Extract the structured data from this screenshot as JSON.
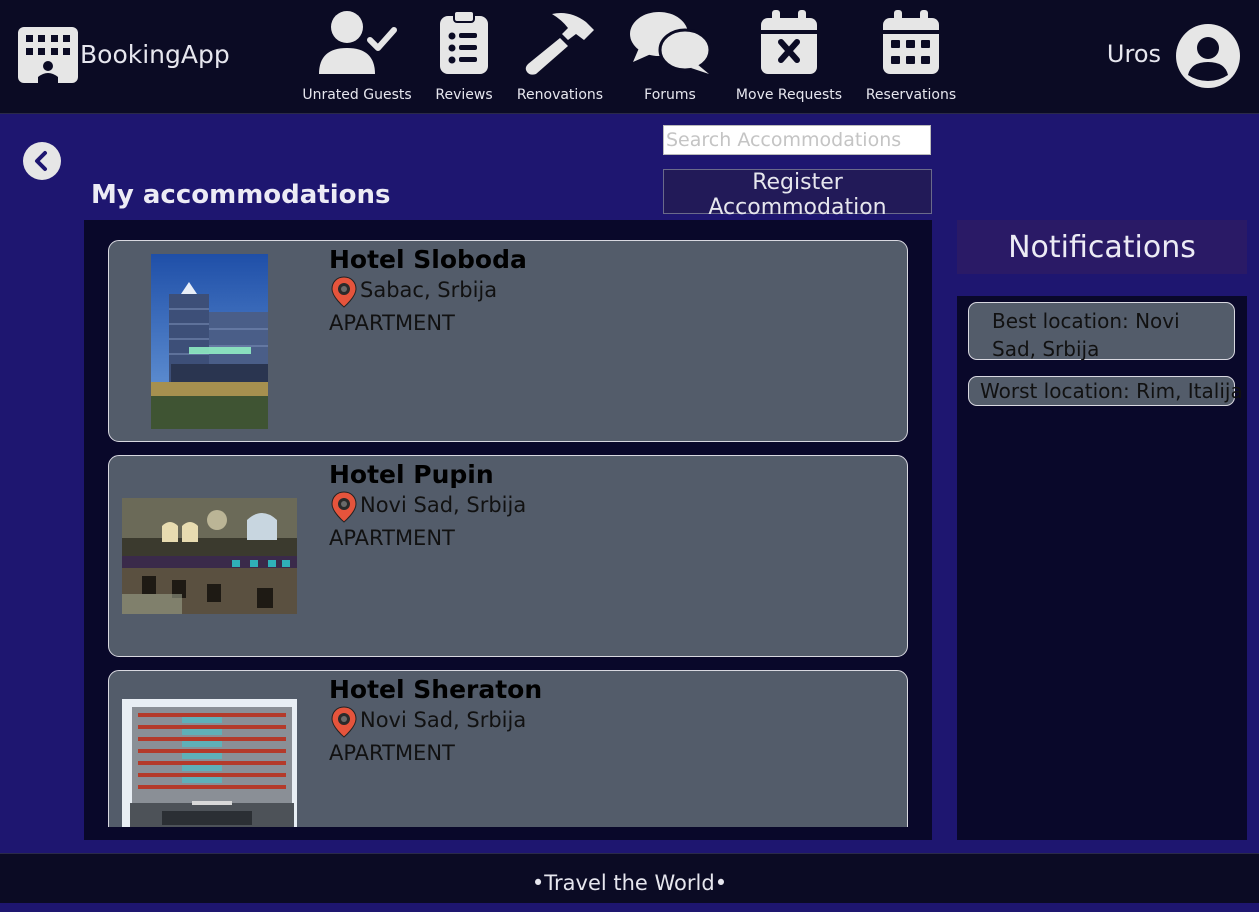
{
  "header": {
    "brand": "BookingApp",
    "nav": [
      {
        "label": "Unrated Guests",
        "icon": "user-check-icon"
      },
      {
        "label": "Reviews",
        "icon": "clipboard-list-icon"
      },
      {
        "label": "Renovations",
        "icon": "hammer-icon"
      },
      {
        "label": "Forums",
        "icon": "chat-bubbles-icon"
      },
      {
        "label": "Move Requests",
        "icon": "calendar-x-icon"
      },
      {
        "label": "Reservations",
        "icon": "calendar-grid-icon"
      }
    ],
    "username": "Uros"
  },
  "main": {
    "title": "My accommodations",
    "search_placeholder": "Search Accommodations",
    "search_value": "",
    "register_label": "Register Accommodation",
    "accommodations": [
      {
        "name": "Hotel Sloboda",
        "location": "Sabac, Srbija",
        "type": "APARTMENT"
      },
      {
        "name": "Hotel Pupin",
        "location": "Novi Sad, Srbija",
        "type": "APARTMENT"
      },
      {
        "name": "Hotel Sheraton",
        "location": "Novi Sad, Srbija",
        "type": "APARTMENT"
      }
    ]
  },
  "notifications": {
    "title": "Notifications",
    "items": [
      "Best location: Novi Sad, Srbija",
      "Worst location: Rim, Italija"
    ]
  },
  "footer": {
    "text": "•Travel the World•"
  },
  "colors": {
    "topbar": "#0b0b24",
    "page_background": "#1e1670",
    "panel": "#09082a",
    "card": "#535c6a",
    "pin": "#e5543c"
  }
}
